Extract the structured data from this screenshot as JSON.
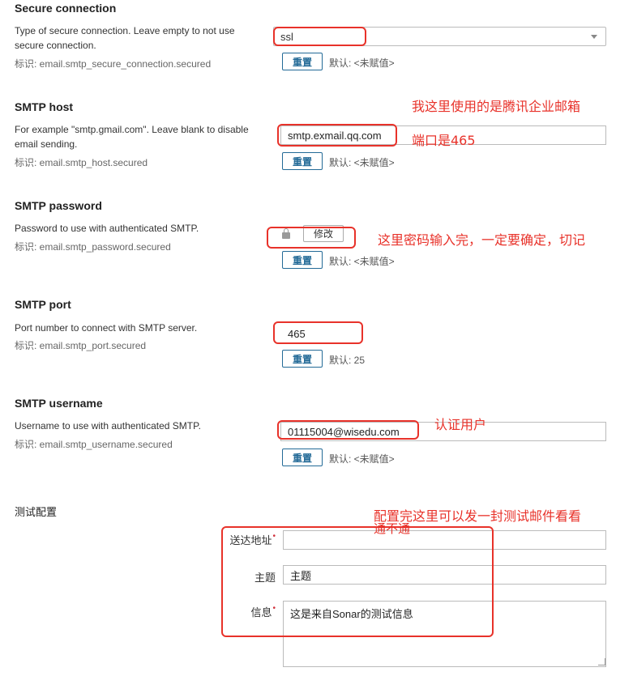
{
  "reset_label": "重置",
  "secure": {
    "title": "Secure connection",
    "description": "Type of secure connection. Leave empty to not use secure connection.",
    "key": "标识: email.smtp_secure_connection.secured",
    "value": "ssl",
    "default": "默认: <未赋值>"
  },
  "host": {
    "title": "SMTP host",
    "description": "For example \"smtp.gmail.com\". Leave blank to disable email sending.",
    "key": "标识: email.smtp_host.secured",
    "value": "smtp.exmail.qq.com",
    "default": "默认: <未赋值>"
  },
  "password": {
    "title": "SMTP password",
    "description": "Password to use with authenticated SMTP.",
    "key": "标识: email.smtp_password.secured",
    "change_label": "修改",
    "default": "默认: <未赋值>"
  },
  "port": {
    "title": "SMTP port",
    "description": "Port number to connect with SMTP server.",
    "key": "标识: email.smtp_port.secured",
    "value": "465",
    "default": "默认: 25"
  },
  "username": {
    "title": "SMTP username",
    "description": "Username to use with authenticated SMTP.",
    "key": "标识: email.smtp_username.secured",
    "value": "01115004@wisedu.com",
    "default": "默认: <未赋值>"
  },
  "test": {
    "title": "测试配置",
    "to_label": "送达地址",
    "to_value": "",
    "subject_label": "主题",
    "subject_value": "主题",
    "message_label": "信息",
    "message_value": "这是来自Sonar的测试信息"
  },
  "annotations": {
    "mail_provider": "我这里使用的是腾讯企业邮箱",
    "port_note": "端口是465",
    "password_note": "这里密码输入完，一定要确定，切记",
    "user_note": "认证用户",
    "test_note_line1": "配置完这里可以发一封测试邮件看看",
    "test_note_line2": "通不通"
  },
  "colors": {
    "annotation_red": "#e8322a",
    "button_blue": "#236a97"
  }
}
